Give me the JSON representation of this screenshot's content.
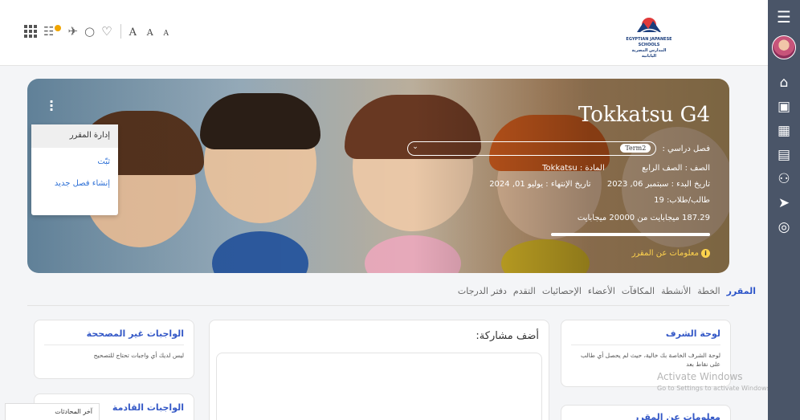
{
  "header": {
    "font_size_labels": [
      "A",
      "A",
      "A"
    ],
    "logo_text_line1": "EGYPTIAN JAPANESE SCHOOLS",
    "logo_text_line2": "المدارس المصرية اليابانية"
  },
  "banner": {
    "course_title": "Tokkatsu G4",
    "term_label": "فصل دراسي :",
    "term_value": "Term2",
    "grade_label": "الصف :",
    "grade_value": "الصف الرابع",
    "subject_label": "المادة :",
    "subject_value": "Tokkatsu",
    "start_label": "تاريخ البدء :",
    "start_value": "سبتمبر 06, 2023",
    "end_label": "تاريخ الإنتهاء :",
    "end_value": "يوليو 01, 2024",
    "students_label": "طالب/طلاب:",
    "students_value": "19",
    "storage_text": "187.29 ميجابايت من 20000 ميجابايت",
    "storage_fraction": 0.0094,
    "course_info_link": "معلومات عن المقرر"
  },
  "menu": {
    "header": "إدارة المقرر",
    "items": [
      "ثبّت",
      "إنشاء فصل جديد"
    ]
  },
  "tabs": [
    {
      "label": "المقرر",
      "active": true
    },
    {
      "label": "الخطة",
      "active": false
    },
    {
      "label": "الأنشطة",
      "active": false
    },
    {
      "label": "المكافآت",
      "active": false
    },
    {
      "label": "الأعضاء",
      "active": false
    },
    {
      "label": "الإحصائيات",
      "active": false
    },
    {
      "label": "التقدم",
      "active": false
    },
    {
      "label": "دفتر الدرجات",
      "active": false
    }
  ],
  "cards": {
    "leaderboard_title": "لوحة الشرف",
    "leaderboard_body": "لوحة الشرف الخاصة بك خالية، حيث لم يحصل أي طالب على نقاط بعد",
    "course_about_title": "معلومات عن المقرر",
    "post_title": "أضف مشاركة:",
    "ungraded_title": "الواجبات غير المصححة",
    "ungraded_body": "ليس لديك أي واجبات تحتاج للتصحيح",
    "upcoming_title": "الواجبات القادمة"
  },
  "watermark": {
    "line1": "Activate Windows",
    "line2": "Go to Settings to activate Windows."
  },
  "chat": {
    "label": "آخر المحادثات"
  },
  "colors": {
    "sidebar": "#4a5568",
    "accent": "#2d55c9",
    "link": "#2c6fd6"
  }
}
